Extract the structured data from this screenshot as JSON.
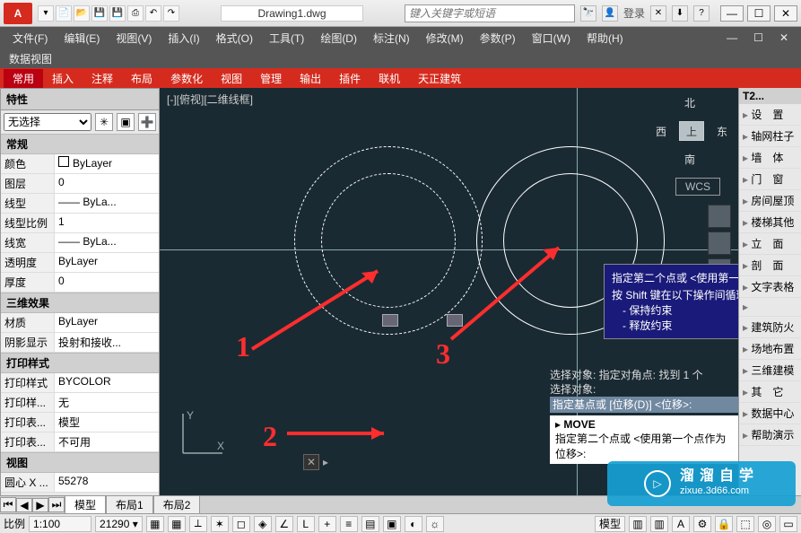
{
  "title": "Drawing1.dwg",
  "search_placeholder": "键入关键字或短语",
  "login_text": "登录",
  "menus": [
    "文件(F)",
    "编辑(E)",
    "视图(V)",
    "插入(I)",
    "格式(O)",
    "工具(T)",
    "绘图(D)",
    "标注(N)",
    "修改(M)",
    "参数(P)",
    "窗口(W)",
    "帮助(H)"
  ],
  "data_tab": "数据视图",
  "ribbon_tabs": [
    "常用",
    "插入",
    "注释",
    "布局",
    "参数化",
    "视图",
    "管理",
    "输出",
    "插件",
    "联机",
    "天正建筑"
  ],
  "props": {
    "title": "特性",
    "selection": "无选择",
    "groups": [
      {
        "name": "常规",
        "rows": [
          {
            "k": "颜色",
            "v": "ByLayer"
          },
          {
            "k": "图层",
            "v": "0"
          },
          {
            "k": "线型",
            "v": "—— ByLa..."
          },
          {
            "k": "线型比例",
            "v": "1"
          },
          {
            "k": "线宽",
            "v": "—— ByLa..."
          },
          {
            "k": "透明度",
            "v": "ByLayer"
          },
          {
            "k": "厚度",
            "v": "0"
          }
        ]
      },
      {
        "name": "三维效果",
        "rows": [
          {
            "k": "材质",
            "v": "ByLayer"
          },
          {
            "k": "阴影显示",
            "v": "投射和接收..."
          }
        ]
      },
      {
        "name": "打印样式",
        "rows": [
          {
            "k": "打印样式",
            "v": "BYCOLOR"
          },
          {
            "k": "打印样...",
            "v": "无"
          },
          {
            "k": "打印表...",
            "v": "模型"
          },
          {
            "k": "打印表...",
            "v": "不可用"
          }
        ]
      },
      {
        "name": "视图",
        "rows": [
          {
            "k": "圆心 X ...",
            "v": "55278"
          }
        ]
      }
    ]
  },
  "viewport_label": "[-][俯视][二维线框]",
  "navcube": {
    "n": "北",
    "s": "南",
    "e": "东",
    "w": "西",
    "top": "上"
  },
  "wcs": "WCS",
  "cmd": {
    "l1": "选择对象: 指定对角点: 找到 1 个",
    "l2": "选择对象:",
    "l3": "指定基点或 [位移(D)] <位移>:",
    "move": "MOVE",
    "l4": "指定第二个点或 <使用第一个点作为位移>:"
  },
  "tooltip": {
    "l1": "指定第二个点或 <使用第一个点作为位移>",
    "l2": "按 Shift 键在以下操作间循环:",
    "s1": "- 保持约束",
    "s2": "- 释放约束"
  },
  "ann": {
    "n1": "1",
    "n2": "2",
    "n3": "3"
  },
  "ucs": {
    "x": "X",
    "y": "Y"
  },
  "cmdline": {
    "icon": "✕",
    "arrow": "▸"
  },
  "layout_tabs": [
    "模型",
    "布局1",
    "布局2"
  ],
  "rtree": {
    "title": "T2...",
    "items": [
      "设　置",
      "轴网柱子",
      "墙　体",
      "门　窗",
      "房间屋顶",
      "楼梯其他",
      "立　面",
      "剖　面",
      "文字表格",
      "",
      "建筑防火",
      "场地布置",
      "三维建模",
      "其　它",
      "数据中心",
      "帮助演示"
    ]
  },
  "status": {
    "scale_label": "比例",
    "scale": "1:100",
    "coords": "21290 ▾",
    "right_label": "模型"
  },
  "watermark": {
    "brand": "溜溜自学",
    "url": "zixue.3d66.com"
  },
  "win": {
    "min": "—",
    "max": "☐",
    "close": "✕"
  }
}
